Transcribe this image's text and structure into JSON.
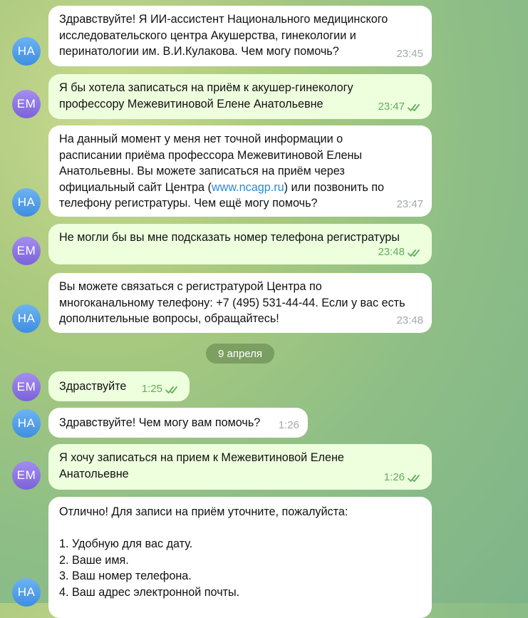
{
  "avatars": {
    "assistant": "НА",
    "user": "ЕМ"
  },
  "date_separator": "9 апреля",
  "messages": [
    {
      "id": "m1",
      "text": "Здравствуйте! Я ИИ-ассистент Национального медицинского\nисследовательского центра Акушерства, гинекологии и\nперинатологии им. В.И.Кулакова. Чем могу помочь?",
      "time": "23:45"
    },
    {
      "id": "m2",
      "text": "Я бы хотела записаться на приём к акушер-гинекологу\nпрофессору Межевитиновой Елене Анатольевне",
      "time": "23:47"
    },
    {
      "id": "m3",
      "text_before": "На данный момент у меня нет точной информации о\nрасписании приёма профессора Межевитиновой Елены\nАнатольевны. Вы можете записаться на приём через\nофициальный сайт Центра (",
      "link": "www.ncagp.ru",
      "text_after": ") или позвонить по\nтелефону регистратуры. Чем ещё могу помочь?",
      "time": "23:47"
    },
    {
      "id": "m4",
      "text": "Не могли бы вы мне подсказать номер телефона регистратуры",
      "time": "23:48"
    },
    {
      "id": "m5",
      "text": "Вы можете связаться с регистратурой Центра по\nмногоканальному телефону: +7 (495) 531-44-44. Если у вас есть\nдополнительные вопросы, обращайтесь!",
      "time": "23:48"
    },
    {
      "id": "m6",
      "text": "Здраствуйте",
      "time": "1:25"
    },
    {
      "id": "m7",
      "text": "Здравствуйте! Чем могу вам помочь?",
      "time": "1:26"
    },
    {
      "id": "m8",
      "text": "Я хочу записаться на прием к Межевитиновой Елене\nАнатольевне",
      "time": "1:26"
    },
    {
      "id": "m9",
      "text": "Отлично! Для записи на приём уточните, пожалуйста:\n\n1. Удобную для вас дату.\n2. Ваше имя.\n3. Ваш номер телефона.\n4. Ваш адрес электронной почты."
    }
  ]
}
